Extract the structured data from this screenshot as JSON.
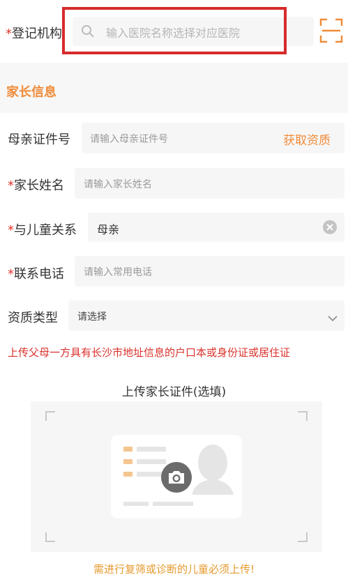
{
  "registration": {
    "required_mark": "*",
    "label": "登记机构",
    "search_placeholder": "输入医院名称选择对应医院"
  },
  "section": {
    "title": "家长信息"
  },
  "fields": {
    "mother_id": {
      "label": "母亲证件号",
      "placeholder": "请输入母亲证件号",
      "action": "获取资质"
    },
    "parent_name": {
      "required_mark": "*",
      "label": "家长姓名",
      "placeholder": "请输入家长姓名"
    },
    "relation": {
      "required_mark": "*",
      "label": "与儿童关系",
      "value": "母亲"
    },
    "phone": {
      "required_mark": "*",
      "label": "联系电话",
      "placeholder": "请输入常用电话"
    },
    "qualification": {
      "label": "资质类型",
      "value": "请选择"
    }
  },
  "notice": "上传父母一方具有长沙市地址信息的户口本或身份证或居住证",
  "upload": {
    "title": "上传家长证件(选填)",
    "footer": "需进行复筛或诊断的儿童必须上传!"
  },
  "colors": {
    "accent": "#f08c3a",
    "required": "#e0372f",
    "notice": "#d9312b",
    "footer": "#e69a2e",
    "highlight_border": "#d62b2b"
  },
  "icons": [
    "search-icon",
    "scan-icon",
    "clear-icon",
    "chevron-down-icon",
    "camera-icon"
  ]
}
